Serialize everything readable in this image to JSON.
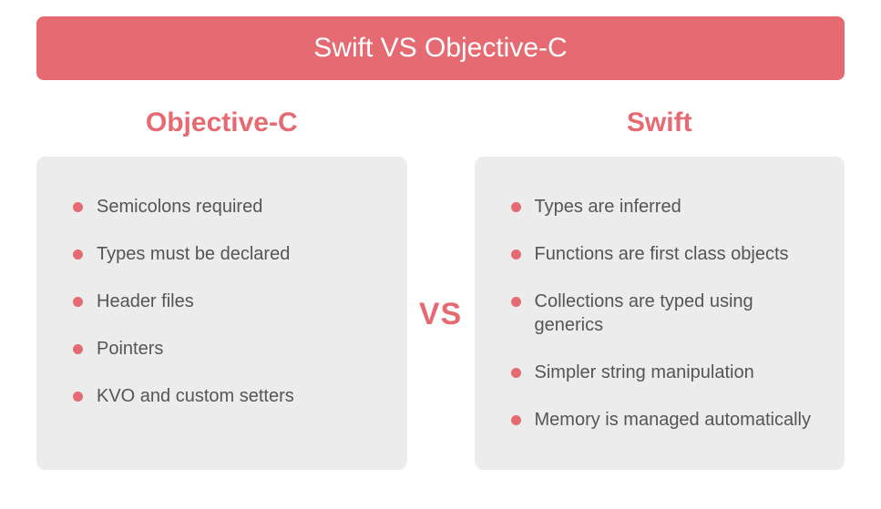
{
  "title": "Swift VS Objective-C",
  "left": {
    "header": "Objective-C",
    "items": [
      "Semicolons required",
      "Types must be declared",
      "Header files",
      "Pointers",
      "KVO and custom setters"
    ]
  },
  "right": {
    "header": "Swift",
    "items": [
      "Types are inferred",
      "Functions are first class objects",
      "Collections are typed using generics",
      "Simpler string manipulation",
      "Memory is managed automatically"
    ]
  },
  "vs_label": "VS"
}
